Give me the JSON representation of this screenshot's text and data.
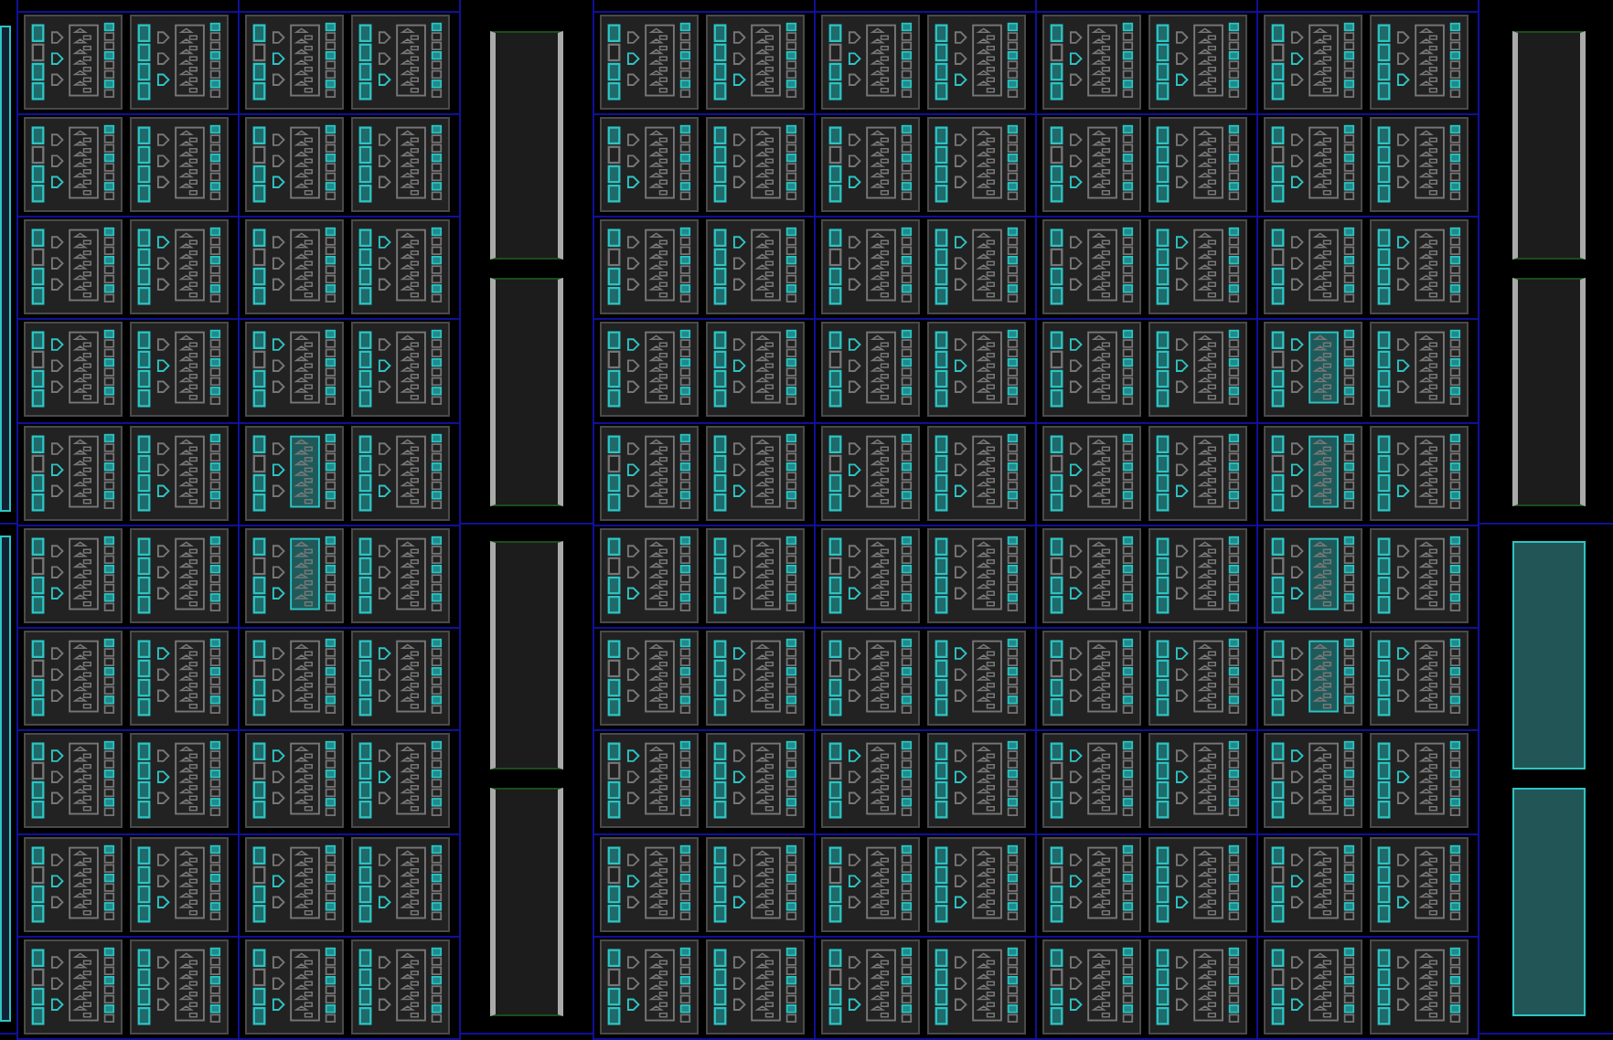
{
  "device_view": {
    "columns": [
      {
        "kind": "bram_edge",
        "blocks": [
          {
            "used": true,
            "selected": false
          },
          {
            "used": true,
            "selected": false
          }
        ]
      },
      {
        "kind": "clb",
        "rows": [
          [
            {
              "selected": false
            },
            {
              "selected": false
            }
          ],
          [
            {
              "selected": false
            },
            {
              "selected": false
            }
          ],
          [
            {
              "selected": false
            },
            {
              "selected": false
            }
          ],
          [
            {
              "selected": false
            },
            {
              "selected": false
            }
          ],
          [
            {
              "selected": false
            },
            {
              "selected": false
            }
          ],
          [
            {
              "selected": false
            },
            {
              "selected": false
            }
          ],
          [
            {
              "selected": false
            },
            {
              "selected": false
            }
          ],
          [
            {
              "selected": false
            },
            {
              "selected": false
            }
          ],
          [
            {
              "selected": false
            },
            {
              "selected": false
            }
          ],
          [
            {
              "selected": false
            },
            {
              "selected": false
            }
          ]
        ]
      },
      {
        "kind": "clb",
        "rows": [
          [
            {
              "selected": false
            },
            {
              "selected": false
            }
          ],
          [
            {
              "selected": false
            },
            {
              "selected": false
            }
          ],
          [
            {
              "selected": false
            },
            {
              "selected": false
            }
          ],
          [
            {
              "selected": false
            },
            {
              "selected": false
            }
          ],
          [
            {
              "selected": true
            },
            {
              "selected": false
            }
          ],
          [
            {
              "selected": true
            },
            {
              "selected": false
            }
          ],
          [
            {
              "selected": false
            },
            {
              "selected": false
            }
          ],
          [
            {
              "selected": false
            },
            {
              "selected": false
            }
          ],
          [
            {
              "selected": false
            },
            {
              "selected": false
            }
          ],
          [
            {
              "selected": false
            },
            {
              "selected": false
            }
          ]
        ]
      },
      {
        "kind": "bram",
        "blocks": [
          {
            "used": false,
            "selected": false
          },
          {
            "used": false,
            "selected": false
          },
          {
            "used": false,
            "selected": false
          },
          {
            "used": false,
            "selected": false
          }
        ]
      },
      {
        "kind": "clb",
        "rows": [
          [
            {
              "selected": false
            },
            {
              "selected": false
            }
          ],
          [
            {
              "selected": false
            },
            {
              "selected": false
            }
          ],
          [
            {
              "selected": false
            },
            {
              "selected": false
            }
          ],
          [
            {
              "selected": false
            },
            {
              "selected": false
            }
          ],
          [
            {
              "selected": false
            },
            {
              "selected": false
            }
          ],
          [
            {
              "selected": false
            },
            {
              "selected": false
            }
          ],
          [
            {
              "selected": false
            },
            {
              "selected": false
            }
          ],
          [
            {
              "selected": false
            },
            {
              "selected": false
            }
          ],
          [
            {
              "selected": false
            },
            {
              "selected": false
            }
          ],
          [
            {
              "selected": false
            },
            {
              "selected": false
            }
          ]
        ]
      },
      {
        "kind": "clb",
        "rows": [
          [
            {
              "selected": false
            },
            {
              "selected": false
            }
          ],
          [
            {
              "selected": false
            },
            {
              "selected": false
            }
          ],
          [
            {
              "selected": false
            },
            {
              "selected": false
            }
          ],
          [
            {
              "selected": false
            },
            {
              "selected": false
            }
          ],
          [
            {
              "selected": false
            },
            {
              "selected": false
            }
          ],
          [
            {
              "selected": false
            },
            {
              "selected": false
            }
          ],
          [
            {
              "selected": false
            },
            {
              "selected": false
            }
          ],
          [
            {
              "selected": false
            },
            {
              "selected": false
            }
          ],
          [
            {
              "selected": false
            },
            {
              "selected": false
            }
          ],
          [
            {
              "selected": false
            },
            {
              "selected": false
            }
          ]
        ]
      },
      {
        "kind": "clb",
        "rows": [
          [
            {
              "selected": false
            },
            {
              "selected": false
            }
          ],
          [
            {
              "selected": false
            },
            {
              "selected": false
            }
          ],
          [
            {
              "selected": false
            },
            {
              "selected": false
            }
          ],
          [
            {
              "selected": false
            },
            {
              "selected": false
            }
          ],
          [
            {
              "selected": false
            },
            {
              "selected": false
            }
          ],
          [
            {
              "selected": false
            },
            {
              "selected": false
            }
          ],
          [
            {
              "selected": false
            },
            {
              "selected": false
            }
          ],
          [
            {
              "selected": false
            },
            {
              "selected": false
            }
          ],
          [
            {
              "selected": false
            },
            {
              "selected": false
            }
          ],
          [
            {
              "selected": false
            },
            {
              "selected": false
            }
          ]
        ]
      },
      {
        "kind": "clb",
        "rows": [
          [
            {
              "selected": false
            },
            {
              "selected": false
            }
          ],
          [
            {
              "selected": false
            },
            {
              "selected": false
            }
          ],
          [
            {
              "selected": false
            },
            {
              "selected": false
            }
          ],
          [
            {
              "selected": true
            },
            {
              "selected": false
            }
          ],
          [
            {
              "selected": true
            },
            {
              "selected": false
            }
          ],
          [
            {
              "selected": true
            },
            {
              "selected": false
            }
          ],
          [
            {
              "selected": true
            },
            {
              "selected": false
            }
          ],
          [
            {
              "selected": false
            },
            {
              "selected": false
            }
          ],
          [
            {
              "selected": false
            },
            {
              "selected": false
            }
          ],
          [
            {
              "selected": false
            },
            {
              "selected": false
            }
          ]
        ]
      },
      {
        "kind": "bram",
        "blocks": [
          {
            "used": false,
            "selected": false
          },
          {
            "used": false,
            "selected": false
          },
          {
            "used": true,
            "selected": true
          },
          {
            "used": true,
            "selected": true
          }
        ]
      }
    ]
  }
}
